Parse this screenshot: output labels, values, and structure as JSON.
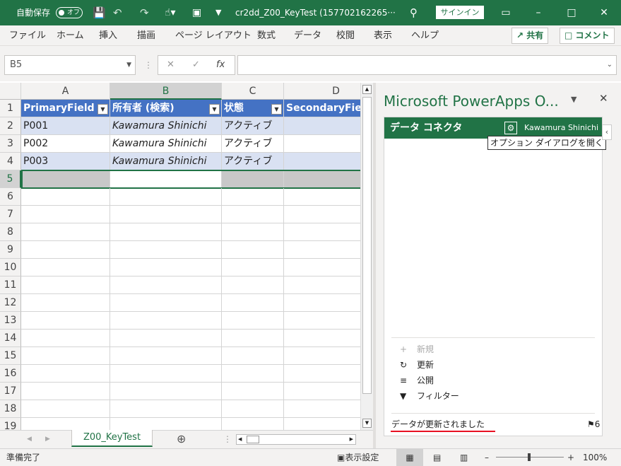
{
  "titlebar": {
    "autosave_label": "自動保存",
    "autosave_state": "オフ",
    "filename": "cr2dd_Z00_KeyTest (157702162265···",
    "signin": "サインイン"
  },
  "ribbon": {
    "tabs": [
      "ファイル",
      "ホーム",
      "挿入",
      "描画",
      "ページ レイアウト",
      "数式",
      "データ",
      "校閲",
      "表示",
      "ヘルプ"
    ],
    "share_label": "共有",
    "comment_label": "コメント"
  },
  "formula": {
    "namebox": "B5",
    "fx_label": "fx",
    "value": ""
  },
  "grid": {
    "columns": [
      "A",
      "B",
      "C",
      "D"
    ],
    "rows": [
      "1",
      "2",
      "3",
      "4",
      "5",
      "6",
      "7",
      "8",
      "9",
      "10",
      "11",
      "12",
      "13",
      "14",
      "15",
      "16",
      "17",
      "18",
      "19"
    ],
    "header": [
      "PrimaryField",
      "所有者 (検索)",
      "状態",
      "SecondaryFiel"
    ],
    "data": [
      [
        "P001",
        "Kawamura Shinichi",
        "アクティブ",
        ""
      ],
      [
        "P002",
        "Kawamura Shinichi",
        "アクティブ",
        ""
      ],
      [
        "P003",
        "Kawamura Shinichi",
        "アクティブ",
        ""
      ]
    ]
  },
  "sheet": {
    "tab": "Z00_KeyTest"
  },
  "pane": {
    "title": "Microsoft PowerApps O...",
    "header": "データ コネクタ",
    "user": "Kawamura Shinichi",
    "tooltip": "オプション ダイアログを開く",
    "actions": {
      "new": "新規",
      "refresh": "更新",
      "publish": "公開",
      "filter": "フィルター"
    },
    "status": "データが更新されました",
    "flag_count": "6"
  },
  "statusbar": {
    "ready": "準備完了",
    "display_settings": "表示設定",
    "zoom": "100%"
  },
  "colors": {
    "excel_green": "#217346",
    "table_header": "#4472c4",
    "table_band": "#d9e1f2"
  }
}
